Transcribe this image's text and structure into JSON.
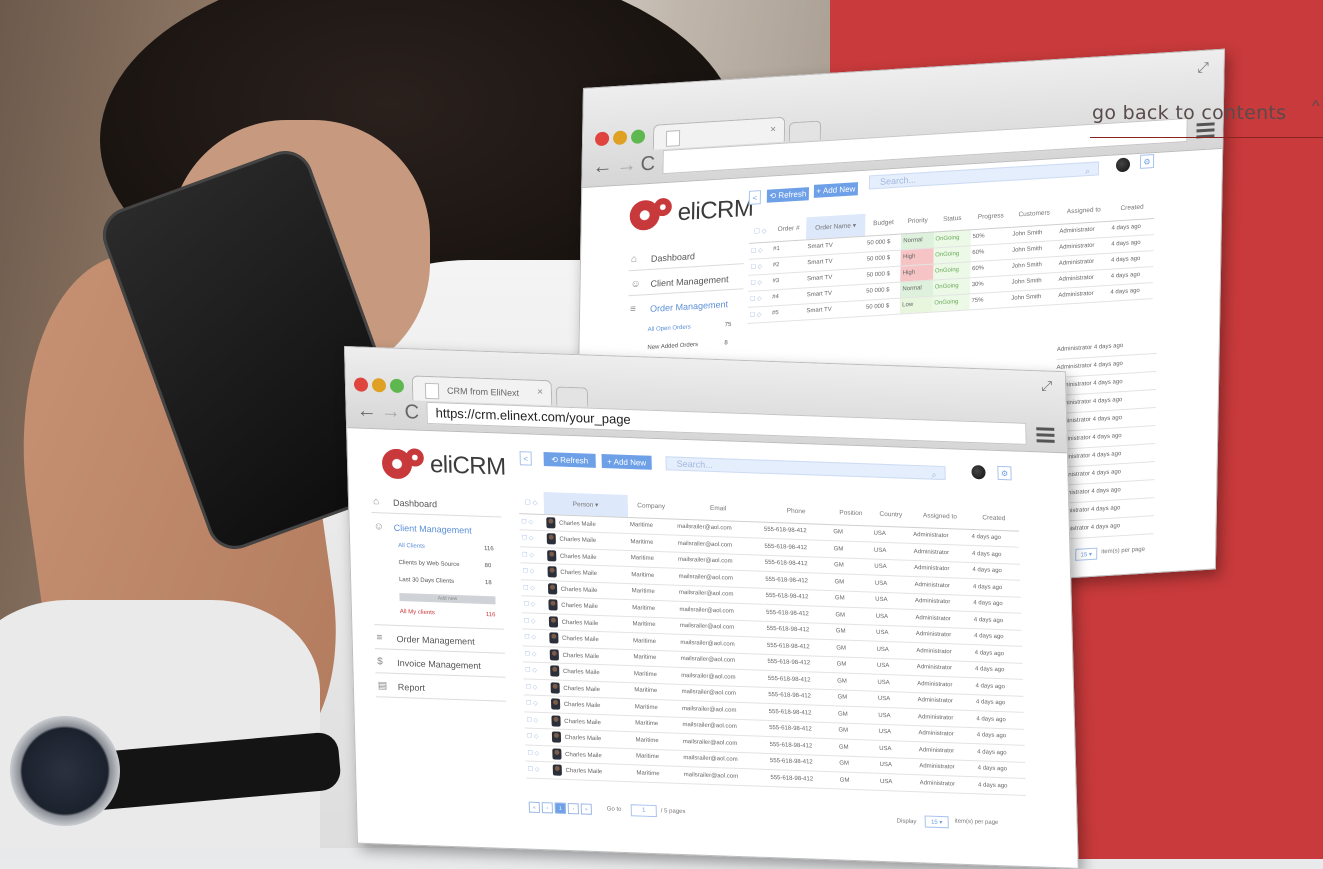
{
  "link": {
    "label": "go back to contents",
    "caret": "^"
  },
  "back_browser": {
    "nav": {
      "back": "←",
      "forward": "→",
      "reload": "C"
    },
    "tab": {
      "close": "×"
    },
    "logo": "eliCRM",
    "toolbar": {
      "back": "<",
      "refresh": "⟲ Refresh",
      "add": "+ Add New",
      "search_placeholder": "Search..."
    },
    "menu": [
      {
        "icon": "⌂",
        "label": "Dashboard"
      },
      {
        "icon": "☺",
        "label": "Client Management"
      },
      {
        "icon": "≡",
        "label": "Order Management"
      }
    ],
    "sub": [
      {
        "label": "All Open Orders",
        "count": "75"
      },
      {
        "label": "New Added Orders",
        "count": "8"
      }
    ],
    "columns": [
      "Order #",
      "Order Name ▾",
      "Budget",
      "Priority",
      "Status",
      "Progress",
      "Customers",
      "Assigned to",
      "Created"
    ],
    "rows": [
      {
        "id": "#1",
        "name": "Smart TV",
        "budget": "50 000 $",
        "priority": "Normal",
        "status": "OnGoing",
        "progress": "50%",
        "customer": "John Smith",
        "assigned": "Administrator",
        "created": "4 days ago"
      },
      {
        "id": "#2",
        "name": "Smart TV",
        "budget": "50 000 $",
        "priority": "High",
        "status": "OnGoing",
        "progress": "60%",
        "customer": "John Smith",
        "assigned": "Administrator",
        "created": "4 days ago"
      },
      {
        "id": "#3",
        "name": "Smart TV",
        "budget": "50 000 $",
        "priority": "High",
        "status": "OnGoing",
        "progress": "60%",
        "customer": "John Smith",
        "assigned": "Administrator",
        "created": "4 days ago"
      },
      {
        "id": "#4",
        "name": "Smart TV",
        "budget": "50 000 $",
        "priority": "Normal",
        "status": "OnGoing",
        "progress": "30%",
        "customer": "John Smith",
        "assigned": "Administrator",
        "created": "4 days ago"
      },
      {
        "id": "#5",
        "name": "Smart TV",
        "budget": "50 000 $",
        "priority": "Low",
        "status": "OnGoing",
        "progress": "75%",
        "customer": "John Smith",
        "assigned": "Administrator",
        "created": "4 days ago"
      }
    ],
    "extra_rows": [
      "Administrator  4 days ago",
      "Administrator  4 days ago",
      "Administrator  4 days ago",
      "Administrator  4 days ago",
      "Administrator  4 days ago",
      "Administrator  4 days ago",
      "Administrator  4 days ago",
      "Administrator  4 days ago",
      "Administrator  4 days ago",
      "Administrator  4 days ago",
      "Administrator  4 days ago"
    ],
    "display": {
      "label": "play",
      "value": "15 ▾",
      "suffix": "item(s) per page"
    }
  },
  "front_browser": {
    "nav": {
      "back": "←",
      "forward": "→",
      "reload": "C"
    },
    "tab_title": "CRM from EliNext",
    "tab_close": "×",
    "url": "https://crm.elinext.com/your_page",
    "logo": "eliCRM",
    "toolbar": {
      "back": "<",
      "refresh": "⟲ Refresh",
      "add": "+ Add New",
      "search_placeholder": "Search...",
      "search_icon": "⌕"
    },
    "menu": [
      {
        "icon": "⌂",
        "label": "Dashboard"
      },
      {
        "icon": "☺",
        "label": "Client Management"
      },
      {
        "icon": "≡",
        "label": "Order Management"
      },
      {
        "icon": "$",
        "label": "Invoice Management"
      },
      {
        "icon": "▤",
        "label": "Report"
      }
    ],
    "sub": [
      {
        "label": "All Clients",
        "count": "116"
      },
      {
        "label": "Clients by Web Source",
        "count": "80"
      },
      {
        "label": "Last 30 Days Clients",
        "count": "18"
      },
      {
        "label": "Add new",
        "count": ""
      },
      {
        "label": "All My clients",
        "count": "116"
      }
    ],
    "columns": [
      "Person ▾",
      "Company",
      "Email",
      "Phone",
      "Position",
      "Country",
      "Assigned to",
      "Created"
    ],
    "row": {
      "person": "Charles Maile",
      "company": "Maritime",
      "email": "mailsrailer@aol.com",
      "phone": "555-618-98-412",
      "position": "GM",
      "country": "USA",
      "assigned": "Administrator",
      "created": "4 days ago"
    },
    "row_count": 16,
    "pager": {
      "first": "«",
      "prev": "‹",
      "current": "1",
      "next": "›",
      "last": "»",
      "goto": "Go to",
      "goto_val": "1",
      "pages": "/ 5 pages"
    },
    "display": {
      "label": "Display",
      "value": "15 ▾",
      "suffix": "item(s) per page"
    }
  },
  "colors": {
    "accent": "#6ea0e8",
    "brand_red": "#c83a3b"
  }
}
